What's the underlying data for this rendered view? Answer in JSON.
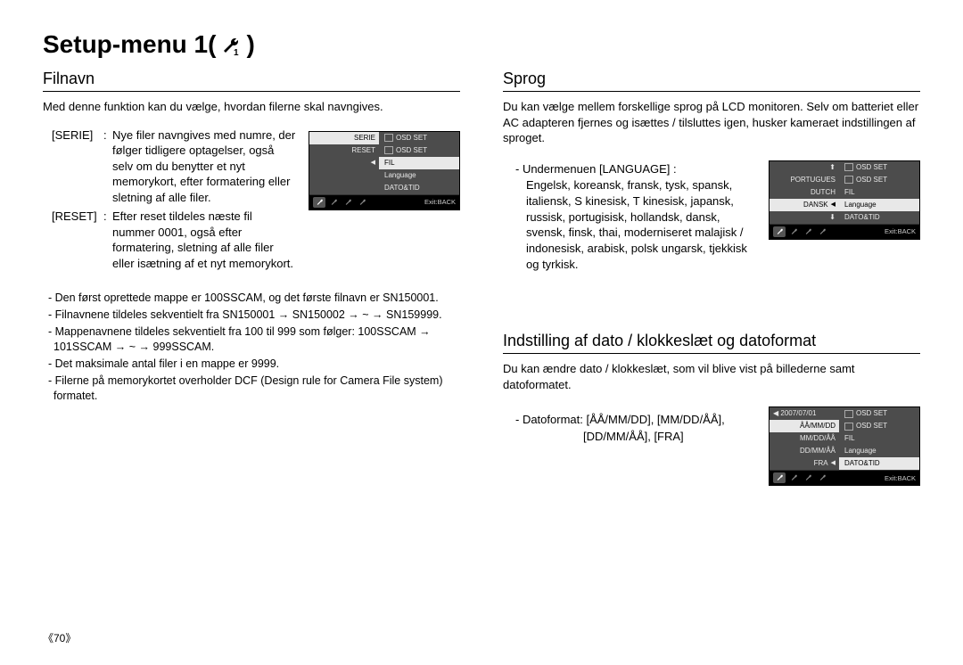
{
  "title_prefix": "Setup-menu 1(",
  "title_suffix": " )",
  "left": {
    "heading": "Filnavn",
    "intro": "Med denne funktion kan du vælge, hvordan filerne skal navngives.",
    "defs": [
      {
        "label": "[SERIE]",
        "body": "Nye filer navngives med numre, der følger tidligere optagelser, også selv om du benytter et nyt memorykort, efter formatering eller sletning af alle filer."
      },
      {
        "label": "[RESET]",
        "body": "Efter reset tildeles næste fil nummer 0001, også efter formatering, sletning af alle filer eller isætning af et nyt memorykort."
      }
    ],
    "bullets": [
      "- Den først oprettede mappe er 100SSCAM, og det første filnavn er SN150001.",
      "- Filnavnene tildeles sekventielt fra SN150001 → SN150002 → ~ → SN159999.",
      "- Mappenavnene tildeles sekventielt fra 100 til 999 som følger: 100SSCAM → 101SSCAM → ~ → 999SSCAM.",
      "- Det maksimale antal filer i en mappe er 9999.",
      "- Filerne på memorykortet overholder DCF (Design rule for Camera File system) formatet."
    ],
    "menu": {
      "left": [
        "SERIE",
        "RESET",
        "",
        "",
        ""
      ],
      "left_hl": 0,
      "right": [
        "OSD SET",
        "OSD SET",
        "FIL",
        "Language",
        "DATO&TID"
      ],
      "right_hl": 2,
      "exit": "Exit:BACK"
    }
  },
  "right1": {
    "heading": "Sprog",
    "intro": "Du kan vælge mellem forskellige sprog på LCD monitoren. Selv om batteriet eller AC adapteren fjernes og isættes / tilsluttes igen, husker kameraet indstillingen af sproget.",
    "submenu_label": "- Undermenuen [LANGUAGE] :",
    "langs": "Engelsk, koreansk, fransk, tysk, spansk, italiensk, S kinesisk, T kinesisk, japansk, russisk, portugisisk, hollandsk, dansk, svensk, finsk, thai, moderniseret malajisk / indonesisk, arabisk, polsk ungarsk, tjekkisk og tyrkisk.",
    "menu": {
      "left": [
        "⬆",
        "PORTUGUES",
        "DUTCH",
        "DANSK",
        "⬇"
      ],
      "left_hl": 3,
      "right": [
        "OSD SET",
        "OSD SET",
        "FIL",
        "Language",
        "DATO&TID"
      ],
      "right_hl": 3,
      "exit": "Exit:BACK"
    }
  },
  "right2": {
    "heading": "Indstilling af dato / klokkeslæt og datoformat",
    "intro": "Du kan ændre dato / klokkeslæt, som vil blive vist på billederne samt datoformatet.",
    "fmt_label": "- Datoformat: [ÅÅ/MM/DD], [MM/DD/ÅÅ],",
    "fmt_label2": "[DD/MM/ÅÅ], [FRA]",
    "menu": {
      "left_top": "◀   2007/07/01",
      "left": [
        "ÅÅ/MM/DD",
        "MM/DD/ÅÅ",
        "DD/MM/ÅÅ",
        "FRA"
      ],
      "left_hl": 0,
      "right": [
        "OSD SET",
        "OSD SET",
        "FIL",
        "Language",
        "DATO&TID"
      ],
      "right_hl": 4,
      "exit": "Exit:BACK"
    }
  },
  "page_number": "《70》"
}
